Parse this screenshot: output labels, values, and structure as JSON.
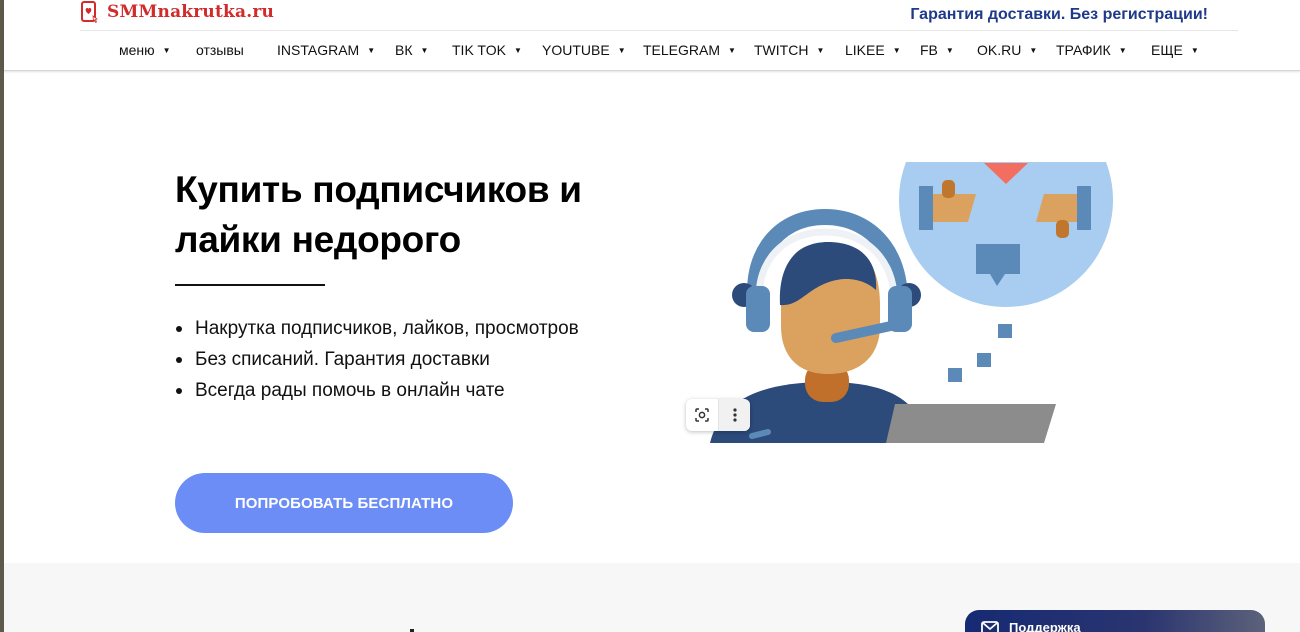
{
  "brand": {
    "name": "SMMnakrutka.ru",
    "color": "#d12b2b"
  },
  "header": {
    "tagline": "Гарантия доставки. Без регистрации!"
  },
  "nav": [
    {
      "label": "меню",
      "dropdown": true
    },
    {
      "label": "отзывы",
      "dropdown": false
    },
    {
      "label": "INSTAGRAM",
      "dropdown": true
    },
    {
      "label": "ВК",
      "dropdown": true
    },
    {
      "label": "TIK TOK",
      "dropdown": true
    },
    {
      "label": "YOUTUBE",
      "dropdown": true
    },
    {
      "label": "TELEGRAM",
      "dropdown": true
    },
    {
      "label": "TWITCH",
      "dropdown": true
    },
    {
      "label": "LIKEE",
      "dropdown": true
    },
    {
      "label": "FB",
      "dropdown": true
    },
    {
      "label": "OK.RU",
      "dropdown": true
    },
    {
      "label": "ТРАФИК",
      "dropdown": true
    },
    {
      "label": "ЕЩЕ",
      "dropdown": true
    }
  ],
  "hero": {
    "title": "Купить подписчиков и лайки недорого",
    "bullets": [
      "Накрутка подписчиков, лайков, просмотров",
      "Без списаний. Гарантия доставки",
      "Всегда рады помочь в онлайн чате"
    ],
    "cta_label": "ПОПРОБОВАТЬ БЕСПЛАТНО",
    "cta_color": "#6b8df5"
  },
  "image_toolbar": {
    "icons": [
      "lens-icon",
      "more-vertical-icon"
    ]
  },
  "support_widget": {
    "label": "Поддержка",
    "icon": "mail-icon"
  }
}
